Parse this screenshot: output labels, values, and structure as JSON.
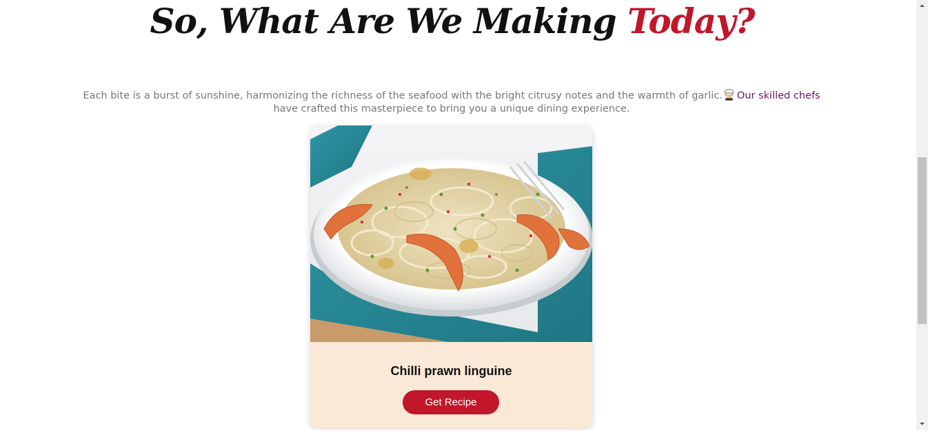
{
  "section": {
    "heading_main": "So, What Are We Making ",
    "heading_accent": "Today?",
    "intro_text": "Each bite is a burst of sunshine, harmonizing the richness of the seafood with the bright citrusy notes and the warmth of garlic.",
    "intro_link": "Our skilled chefs",
    "intro_text_after": " have crafted this masterpiece to bring you a unique dining experience.",
    "chef_icon": "chef-emoji-icon"
  },
  "card": {
    "image_subject": "chilli-prawn-linguine-photo",
    "title": "Chilli prawn linguine",
    "button_label": "Get Recipe"
  },
  "colors": {
    "accent": "#c2162a",
    "link": "#6a1466",
    "card_background": "#f9e9d6",
    "body_text": "#77777c"
  },
  "scrollbar": {
    "position_fraction": 0.4
  }
}
